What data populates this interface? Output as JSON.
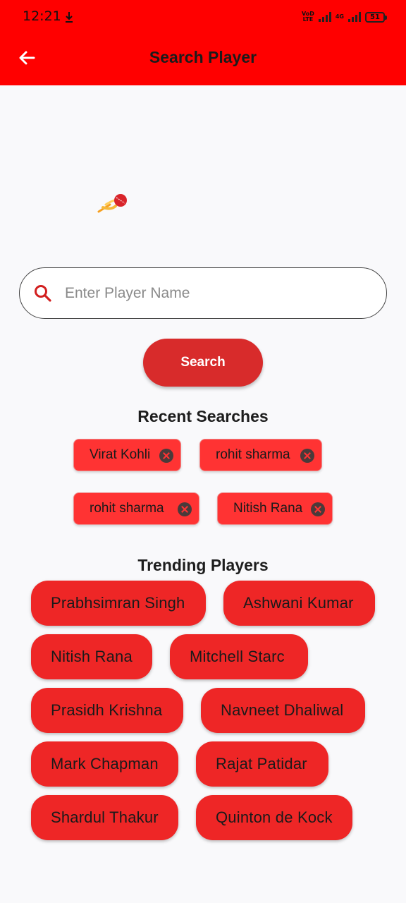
{
  "status_bar": {
    "time": "12:21",
    "network_label_top": "VoD",
    "network_label_bottom": "LTE",
    "network_type": "4G",
    "battery": "51"
  },
  "header": {
    "title": "Search Player",
    "background_color": "#ff0000"
  },
  "search": {
    "placeholder": "Enter Player Name",
    "value": "",
    "button_label": "Search"
  },
  "recent": {
    "title": "Recent Searches",
    "items": [
      {
        "label": "Virat Kohli"
      },
      {
        "label": "rohit sharma"
      },
      {
        "label": "rohit sharma"
      },
      {
        "label": "Nitish Rana"
      }
    ]
  },
  "trending": {
    "title": "Trending Players",
    "items": [
      {
        "label": "Prabhsimran Singh"
      },
      {
        "label": "Ashwani Kumar"
      },
      {
        "label": "Nitish Rana"
      },
      {
        "label": "Mitchell Starc"
      },
      {
        "label": "Prasidh Krishna"
      },
      {
        "label": "Navneet Dhaliwal"
      },
      {
        "label": "Mark Chapman"
      },
      {
        "label": "Rajat Patidar"
      },
      {
        "label": "Shardul Thakur"
      },
      {
        "label": "Quinton de Kock"
      }
    ]
  },
  "colors": {
    "accent": "#ff0000",
    "chip": "#ee2626",
    "button": "#d82b2b"
  }
}
